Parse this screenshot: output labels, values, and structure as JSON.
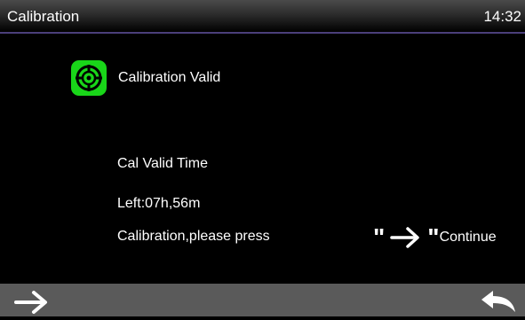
{
  "titlebar": {
    "title": "Calibration",
    "time": "14:32"
  },
  "status": {
    "icon": "calibration-target-icon",
    "text": "Calibration Valid",
    "icon_color": "#19d619"
  },
  "info": {
    "valid_time_label": "Cal Valid Time",
    "remaining": "Left:07h,56m",
    "instruction": "Calibration,please press"
  },
  "continue_hint": {
    "open_quote": "\"",
    "icon": "right-arrow-icon",
    "close_quote": "\"",
    "label": "Continue"
  },
  "bottombar": {
    "next_icon": "right-arrow-icon",
    "back_icon": "back-arrow-icon",
    "background": "#5a5a5a"
  }
}
